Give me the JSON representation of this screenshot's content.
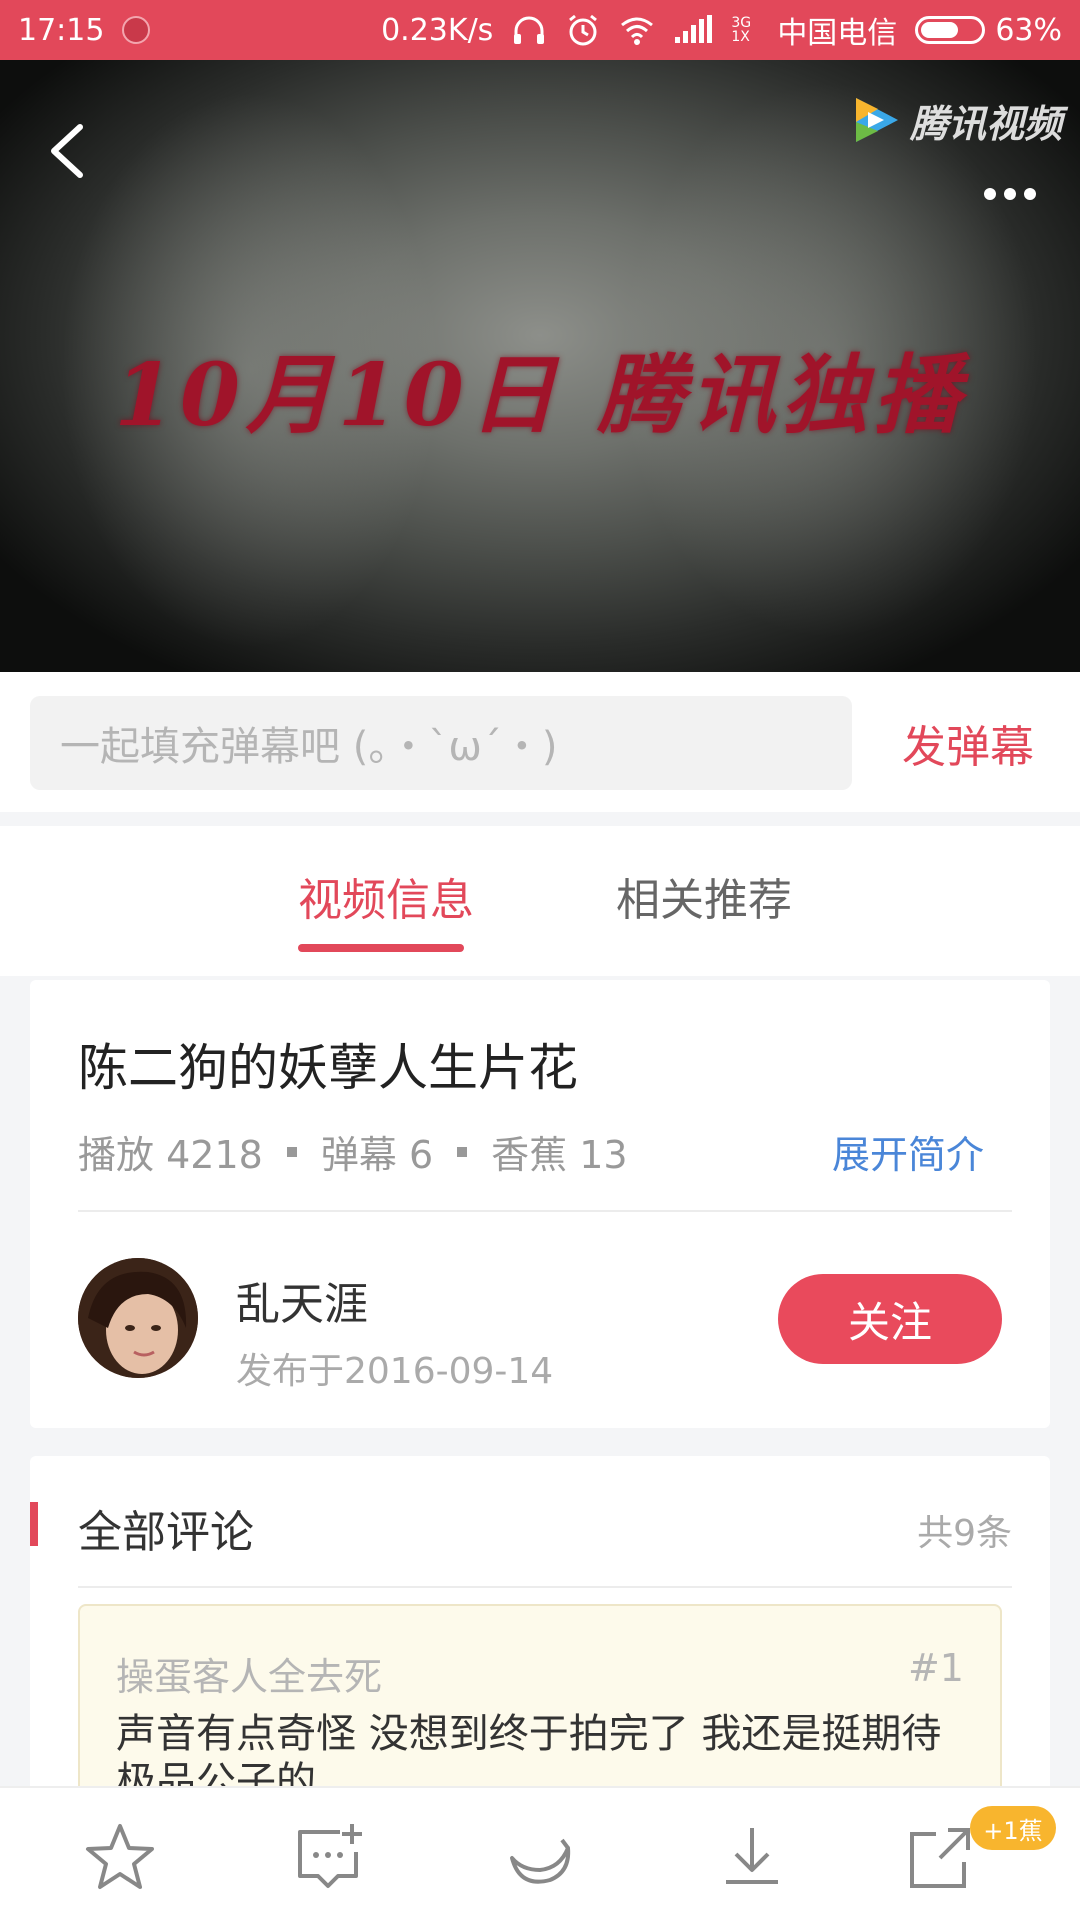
{
  "status_bar": {
    "time": "17:15",
    "network_speed": "0.23K/s",
    "network_type": "3G 1X",
    "carrier": "中国电信",
    "battery_percent": "63%",
    "battery_level": 0.63
  },
  "video": {
    "overlay_text": "10月10日  腾讯独播",
    "brand_label": "腾讯视频",
    "icons": {
      "back": "back-chevron-icon",
      "more": "more-dots-icon",
      "brand": "tencent-video-logo"
    }
  },
  "danmaku": {
    "placeholder": "一起填充弹幕吧 (。・`ω´・)",
    "send_label": "发弹幕"
  },
  "tabs": [
    {
      "label": "视频信息",
      "active": true
    },
    {
      "label": "相关推荐",
      "active": false
    }
  ],
  "info": {
    "title": "陈二狗的妖孽人生片花",
    "stats": {
      "play_label": "播放",
      "play_count": "4218",
      "danmaku_label": "弹幕",
      "danmaku_count": "6",
      "banana_label": "香蕉",
      "banana_count": "13"
    },
    "expand_label": "展开简介",
    "author": {
      "name": "乱天涯",
      "published": "发布于2016-09-14",
      "follow_label": "关注"
    }
  },
  "comments": {
    "title": "全部评论",
    "count_label": "共9条",
    "items": [
      {
        "user": "操蛋客人全去死",
        "index": "#1",
        "text": "声音有点奇怪 没想到终于拍完了 我还是挺期待 极品公子的"
      }
    ]
  },
  "bottom_bar": {
    "items": [
      {
        "icon": "star-icon"
      },
      {
        "icon": "comment-add-icon"
      },
      {
        "icon": "banana-icon"
      },
      {
        "icon": "download-icon"
      },
      {
        "icon": "share-icon"
      }
    ],
    "badge": "+1蕉"
  },
  "colors": {
    "accent": "#e2485a",
    "link": "#4a86d8",
    "badge": "#f8b52e"
  }
}
